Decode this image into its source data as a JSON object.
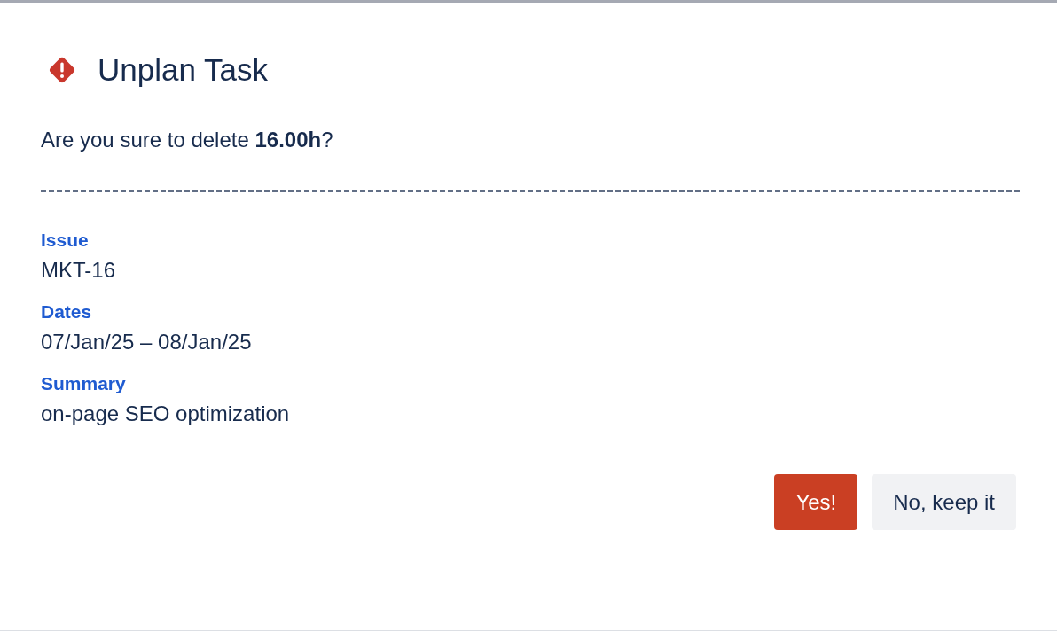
{
  "dialog": {
    "title": "Unplan Task",
    "message": "Are you sure to delete **16.00h**?",
    "fields": [
      {
        "label": "Issue",
        "value": "MKT-16"
      },
      {
        "label": "Dates",
        "value": "07/Jan/25 – 08/Jan/25"
      },
      {
        "label": "Summary",
        "value": "on-page SEO optimization"
      }
    ],
    "buttons": [
      {
        "label": "Yes!",
        "kind": "primary"
      },
      {
        "label": "No, keep it",
        "kind": "secondary"
      }
    ]
  }
}
